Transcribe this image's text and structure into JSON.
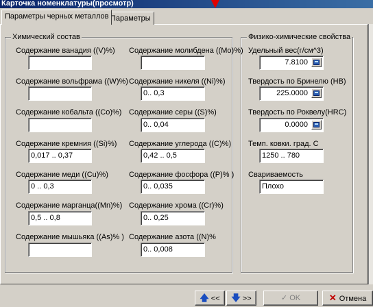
{
  "window": {
    "title": "Карточка номенклатуры(просмотр)"
  },
  "tabs": [
    {
      "label": "Параметры черных металлов"
    },
    {
      "label": "Параметры"
    }
  ],
  "chem": {
    "title": "Химический состав",
    "fields": [
      {
        "label": "Содержание ванадия ((V)%)",
        "value": ""
      },
      {
        "label": "Содержание молибдена ((Mo)%)",
        "value": ""
      },
      {
        "label": "Содержание вольфрама ((W)%)",
        "value": ""
      },
      {
        "label": "Содержание никеля ((Ni)%)",
        "value": "0.. 0,3"
      },
      {
        "label": "Содержание кобальта ((Co)%)",
        "value": ""
      },
      {
        "label": "Содержание серы ((S)%)",
        "value": "0.. 0,04"
      },
      {
        "label": "Содержание кремния ((Si)%)",
        "value": "0,017 .. 0,37"
      },
      {
        "label": "Содержание углерода ((C)%)",
        "value": "0,42 .. 0,5"
      },
      {
        "label": "Содержание меди ((Cu)%)",
        "value": "0 .. 0,3"
      },
      {
        "label": "Содержание фосфора ((P)% )",
        "value": "0.. 0,035"
      },
      {
        "label": "Содержание марганца((Mn)%)",
        "value": "0,5 .. 0,8"
      },
      {
        "label": "Содержание хрома ((Cr)%)",
        "value": "0.. 0,25"
      },
      {
        "label": "Содержание мышьяка ((As)% )",
        "value": ""
      },
      {
        "label": "Содержание азота ((N)%",
        "value": "0.. 0,008"
      }
    ]
  },
  "phys": {
    "title": "Физико-химические свойства",
    "fields": [
      {
        "label": "Удельный вес(г/см^3)",
        "value": "7.8100",
        "icon": "calculator-icon"
      },
      {
        "label": "Твердость по Бринелю (HB)",
        "value": "225.0000",
        "icon": "calculator-icon"
      },
      {
        "label": "Твердость по Роквелу(HRC)",
        "value": "0.0000",
        "icon": "calculator-icon"
      },
      {
        "label": "Темп. ковки.  град. С",
        "value": "1250 .. 780"
      },
      {
        "label": "Свариваемость",
        "value": "Плохо"
      }
    ]
  },
  "buttons": {
    "prev": {
      "label": "<<",
      "icon": "arrow-up-icon"
    },
    "next": {
      "label": ">>",
      "icon": "arrow-down-icon"
    },
    "ok": {
      "label": "OK",
      "icon": "checkmark-icon"
    },
    "cancel": {
      "label": "Отмена",
      "icon": "close-icon"
    }
  },
  "colors": {
    "titlebar": "#0a246a",
    "face": "#d4d0c8",
    "accent_arrow": "#1a4dbf",
    "cancel_icon": "#c00000"
  }
}
